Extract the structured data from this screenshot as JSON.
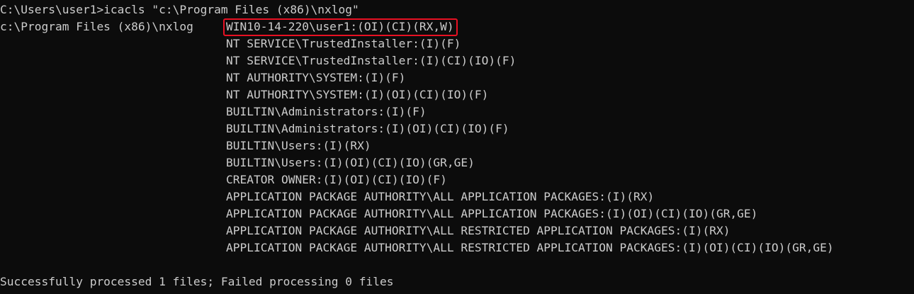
{
  "command": {
    "prompt": "C:\\Users\\user1>",
    "text": "icacls \"c:\\Program Files (x86)\\nxlog\""
  },
  "acl": {
    "target_path": "c:\\Program Files (x86)\\nxlog",
    "first_entry": "WIN10-14-220\\user1:(OI)(CI)(RX,W)",
    "entries": [
      "NT SERVICE\\TrustedInstaller:(I)(F)",
      "NT SERVICE\\TrustedInstaller:(I)(CI)(IO)(F)",
      "NT AUTHORITY\\SYSTEM:(I)(F)",
      "NT AUTHORITY\\SYSTEM:(I)(OI)(CI)(IO)(F)",
      "BUILTIN\\Administrators:(I)(F)",
      "BUILTIN\\Administrators:(I)(OI)(CI)(IO)(F)",
      "BUILTIN\\Users:(I)(RX)",
      "BUILTIN\\Users:(I)(OI)(CI)(IO)(GR,GE)",
      "CREATOR OWNER:(I)(OI)(CI)(IO)(F)",
      "APPLICATION PACKAGE AUTHORITY\\ALL APPLICATION PACKAGES:(I)(RX)",
      "APPLICATION PACKAGE AUTHORITY\\ALL APPLICATION PACKAGES:(I)(OI)(CI)(IO)(GR,GE)",
      "APPLICATION PACKAGE AUTHORITY\\ALL RESTRICTED APPLICATION PACKAGES:(I)(RX)",
      "APPLICATION PACKAGE AUTHORITY\\ALL RESTRICTED APPLICATION PACKAGES:(I)(OI)(CI)(IO)(GR,GE)"
    ]
  },
  "summary": "Successfully processed 1 files; Failed processing 0 files",
  "colors": {
    "background": "#0c0c0c",
    "text": "#cccccc",
    "highlight_border": "#e81123"
  }
}
